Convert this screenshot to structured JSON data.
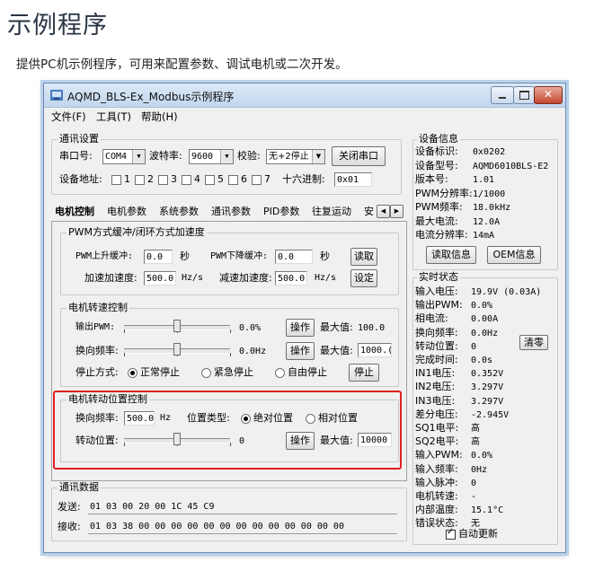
{
  "page": {
    "heading": "示例程序",
    "subtitle": "提供PC机示例程序，可用来配置参数、调试电机或二次开发。"
  },
  "window": {
    "title": "AQMD_BLS-Ex_Modbus示例程序",
    "menu": [
      "文件(F)",
      "工具(T)",
      "帮助(H)"
    ]
  },
  "comm": {
    "group": "通讯设置",
    "port_label": "串口号:",
    "port_value": "COM4",
    "baud_label": "波特率:",
    "baud_value": "9600",
    "parity_label": "校验:",
    "parity_value": "无+2停止",
    "close_btn": "关闭串口",
    "addr_label": "设备地址:",
    "addr_bits": [
      "1",
      "2",
      "3",
      "4",
      "5",
      "6",
      "7"
    ],
    "hex_label": "十六进制:",
    "hex_value": "0x01"
  },
  "tabs": [
    "电机控制",
    "电机参数",
    "系统参数",
    "通讯参数",
    "PID参数",
    "往复运动",
    "安"
  ],
  "pwm": {
    "group": "PWM方式缓冲/闭环方式加速度",
    "up_label": "PWM上升缓冲:",
    "up_value": "0.0",
    "up_unit": "秒",
    "down_label": "PWM下降缓冲:",
    "down_value": "0.0",
    "down_unit": "秒",
    "read_btn": "读取",
    "acc_label": "加速加速度:",
    "acc_value": "500.0",
    "acc_unit": "Hz/s",
    "dec_label": "减速加速度:",
    "dec_value": "500.0",
    "dec_unit": "Hz/s",
    "set_btn": "设定"
  },
  "speed": {
    "group": "电机转速控制",
    "pwm_label": "输出PWM:",
    "pwm_value": "0.0%",
    "pwm_btn": "操作",
    "pwm_max_label": "最大值:",
    "pwm_max": "100.0",
    "freq_label": "换向频率:",
    "freq_value": "0.0Hz",
    "freq_btn": "操作",
    "freq_max_label": "最大值:",
    "freq_max": "1000.(",
    "stop_label": "停止方式:",
    "stop_options": [
      "正常停止",
      "紧急停止",
      "自由停止"
    ],
    "stop_btn": "停止"
  },
  "position": {
    "group": "电机转动位置控制",
    "freq_label": "换向频率:",
    "freq_value": "500.0",
    "freq_unit": "Hz",
    "type_label": "位置类型:",
    "type_options": [
      "绝对位置",
      "相对位置"
    ],
    "rot_label": "转动位置:",
    "rot_value": "0",
    "rot_btn": "操作",
    "rot_max_label": "最大值:",
    "rot_max": "10000"
  },
  "commdata": {
    "group": "通讯数据",
    "send_label": "发送:",
    "send_value": "01 03 00 20 00 1C 45 C9",
    "recv_label": "接收:",
    "recv_value": "01 03 38 00 00 00 00 00 00 00 00 00 00 00 00 00"
  },
  "device": {
    "group": "设备信息",
    "rows": [
      {
        "label": "设备标识:",
        "value": "0x0202"
      },
      {
        "label": "设备型号:",
        "value": "AQMD6010BLS-E2"
      },
      {
        "label": "版本号:",
        "value": "1.01"
      },
      {
        "label": "PWM分辨率:",
        "value": "1/1000"
      },
      {
        "label": "PWM频率:",
        "value": "18.0kHz"
      },
      {
        "label": "最大电流:",
        "value": "12.0A"
      },
      {
        "label": "电流分辨率:",
        "value": "14mA"
      }
    ],
    "read_btn": "读取信息",
    "oem_btn": "OEM信息"
  },
  "status": {
    "group": "实时状态",
    "rows": [
      {
        "label": "输入电压:",
        "value": "19.9V (0.03A)"
      },
      {
        "label": "输出PWM:",
        "value": "0.0%"
      },
      {
        "label": "相电流:",
        "value": "0.00A"
      },
      {
        "label": "换向频率:",
        "value": "0.0Hz"
      },
      {
        "label": "转动位置:",
        "value": "0"
      },
      {
        "label": "完成时间:",
        "value": "0.0s"
      },
      {
        "label": "IN1电压:",
        "value": "0.352V"
      },
      {
        "label": "IN2电压:",
        "value": "3.297V"
      },
      {
        "label": "IN3电压:",
        "value": "3.297V"
      },
      {
        "label": "差分电压:",
        "value": "-2.945V"
      },
      {
        "label": "SQ1电平:",
        "value": "高"
      },
      {
        "label": "SQ2电平:",
        "value": "高"
      },
      {
        "label": "输入PWM:",
        "value": "0.0%"
      },
      {
        "label": "输入频率:",
        "value": "0Hz"
      },
      {
        "label": "输入脉冲:",
        "value": "0"
      },
      {
        "label": "电机转速:",
        "value": "-"
      },
      {
        "label": "内部温度:",
        "value": "15.1°C"
      },
      {
        "label": "错误状态:",
        "value": "无"
      }
    ],
    "clear_btn": "清零",
    "auto_label": "自动更新"
  }
}
